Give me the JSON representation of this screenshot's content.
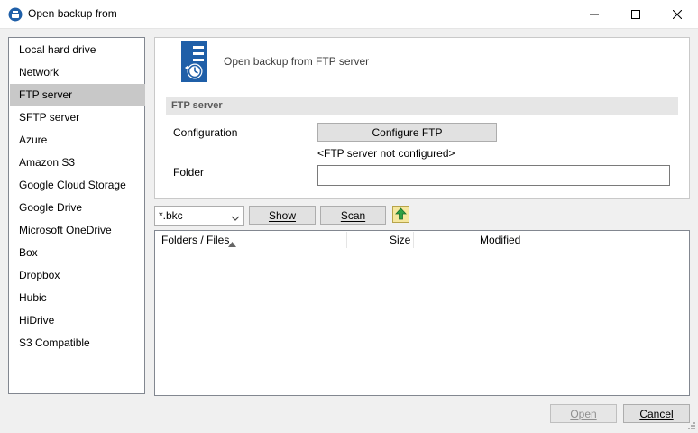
{
  "window": {
    "title": "Open backup from",
    "controls": {
      "minimize": "minimize-icon",
      "maximize": "maximize-icon",
      "close": "close-icon"
    }
  },
  "sources": {
    "items": [
      "Local hard drive",
      "Network",
      "FTP server",
      "SFTP server",
      "Azure",
      "Amazon S3",
      "Google Cloud Storage",
      "Google Drive",
      "Microsoft OneDrive",
      "Box",
      "Dropbox",
      "Hubic",
      "HiDrive",
      "S3 Compatible"
    ],
    "selected": "FTP server"
  },
  "ftp_panel": {
    "header": "Open backup from FTP server",
    "section_title": "FTP server",
    "configuration_label": "Configuration",
    "configure_button": "Configure FTP",
    "status": "<FTP server not configured>",
    "folder_label": "Folder",
    "folder_value": ""
  },
  "filter": {
    "extension": "*.bkc",
    "show_button": "Show",
    "scan_button": "Scan",
    "up_icon": "folder-up-icon"
  },
  "files_table": {
    "columns": [
      "Folders / Files",
      "Size",
      "Modified"
    ],
    "sort_indicator": "sort-ascending-icon",
    "rows": []
  },
  "footer": {
    "open_button": "Open",
    "cancel_button": "Cancel"
  },
  "colors": {
    "selection": "#c8c8c8",
    "accent_blue": "#1f5fa8",
    "up_arrow_green": "#2ea043"
  }
}
